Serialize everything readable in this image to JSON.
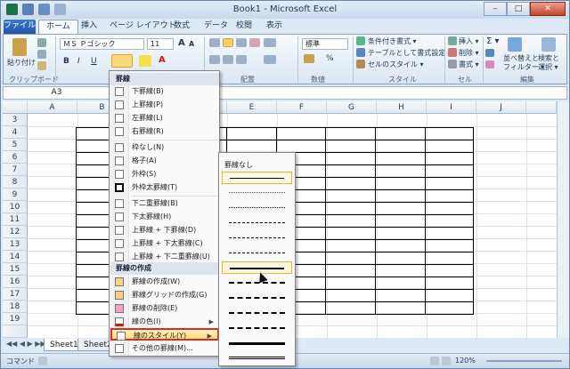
{
  "window": {
    "title": "Book1 - Microsoft Excel",
    "min": "–",
    "max": "□",
    "close": "✕"
  },
  "tabs": [
    "ファイル",
    "ホーム",
    "挿入",
    "ページ レイアウト",
    "数式",
    "データ",
    "校閲",
    "表示"
  ],
  "ribbon": {
    "paste": "貼り付け",
    "clipboard": "クリップボード",
    "font_name": "ＭＳ Ｐゴシック",
    "font_size": "11",
    "bold": "B",
    "italic": "I",
    "underline": "U",
    "grow": "A",
    "shrink": "A",
    "number_format": "標準",
    "cond_format": "条件付き書式 ▾",
    "table_format": "テーブルとして書式設定 ▾",
    "cell_style": "セルのスタイル ▾",
    "insert": "挿入 ▾",
    "delete": "削除 ▾",
    "format": "書式 ▾",
    "sort": "並べ替えと",
    "sort2": "フィルター ▾",
    "find": "検索と",
    "find2": "選択 ▾",
    "sigma": "Σ ▾",
    "groups": {
      "clipboard": "クリップボード",
      "align": "配置",
      "number": "数値",
      "style": "スタイル",
      "cells": "セル",
      "edit": "編集"
    }
  },
  "formula_bar": {
    "name_box": "A3",
    "fx": "fx"
  },
  "columns": [
    "A",
    "B",
    "C",
    "D",
    "E",
    "F",
    "G",
    "H",
    "I",
    "J"
  ],
  "rows": [
    "3",
    "4",
    "5",
    "6",
    "7",
    "8",
    "9",
    "10",
    "11",
    "12",
    "13",
    "14",
    "15",
    "16",
    "17",
    "18",
    "19"
  ],
  "sheets": [
    "Sheet1",
    "Sheet2"
  ],
  "status": {
    "mode": "コマンド",
    "zoom": "120%"
  },
  "menu": {
    "header1": "罫線",
    "items1": [
      "下罫線(B)",
      "上罫線(P)",
      "左罫線(L)",
      "右罫線(R)"
    ],
    "items2": [
      "枠なし(N)",
      "格子(A)",
      "外枠(S)",
      "外枠太罫線(T)"
    ],
    "items3": [
      "下二重罫線(B)",
      "下太罫線(H)",
      "上罫線 + 下罫線(D)",
      "上罫線 + 下太罫線(C)",
      "上罫線 + 下二重罫線(U)"
    ],
    "header2": "罫線の作成",
    "items4": [
      "罫線の作成(W)",
      "罫線グリッドの作成(G)",
      "罫線の削除(E)",
      "線の色(I)",
      "線のスタイル(Y)",
      "その他の罫線(M)..."
    ]
  },
  "submenu": {
    "none": "罫線なし"
  }
}
